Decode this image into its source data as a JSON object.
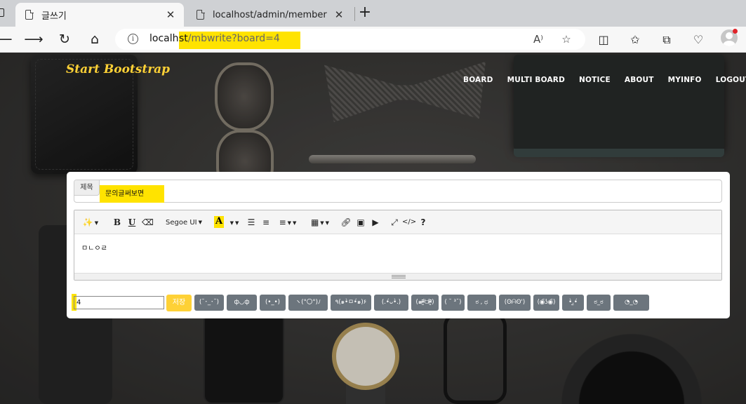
{
  "browser": {
    "tabs": [
      {
        "title": "글쓰기",
        "close": "✕"
      },
      {
        "title": "localhost/admin/member",
        "close": "✕"
      }
    ],
    "new_tab": "+",
    "url": {
      "host": "localho",
      "host_tail": "st",
      "path": "/mbwrite?board=4"
    }
  },
  "site": {
    "brand": "Start Bootstrap",
    "nav": [
      "BOARD",
      "MULTI BOARD",
      "NOTICE",
      "ABOUT",
      "MYINFO",
      "LOGOUT"
    ]
  },
  "form": {
    "title_label": "제목",
    "title_value": "문의글써보면",
    "font_name": "Segoe UI",
    "editor_content": "ㅁㄴㅇㄹ",
    "board_value": "4",
    "save_label": "저장",
    "emoticons": [
      "(˘･_･˘)",
      "ф◡ф",
      "(•_•)",
      "ヽ(°〇°)ﾉ",
      "٩(๑•̀ㅁ•́๑)۶",
      "(.•́ᴗ•̀.)",
      "(๑ᵒ̴̶̷͈᷄ᗨᵒ̴̶̷͈᷅)",
      "( ˘ ³˘)",
      "ಠ , ಥ",
      "(ʘᗩʘ')",
      "(◉̃ʖ◉̃)",
      "•̀.̫•́",
      "ಠ_ಠ",
      "◔_◔"
    ]
  },
  "colors": {
    "accent": "#fed136",
    "highlight": "#ffe300",
    "emoticon_bg": "#6c757d"
  }
}
